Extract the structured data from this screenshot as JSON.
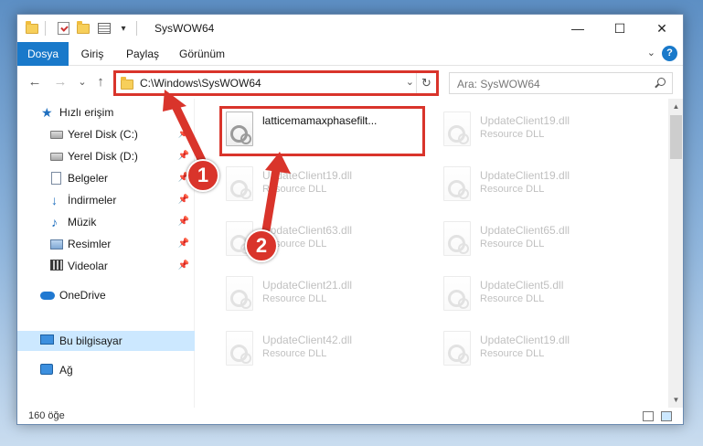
{
  "window": {
    "title": "SysWOW64"
  },
  "ribbon": {
    "tabs": [
      "Dosya",
      "Giriş",
      "Paylaş",
      "Görünüm"
    ],
    "help": "?"
  },
  "window_controls": {
    "minimize": "—",
    "maximize": "☐",
    "close": "✕"
  },
  "nav": {
    "back": "←",
    "forward": "→",
    "recent": "⌄",
    "up": "↑",
    "address": "C:\\Windows\\SysWOW64",
    "refresh": "↻",
    "search_placeholder": "Ara: SysWOW64"
  },
  "sidebar": {
    "items": [
      {
        "label": "Hızlı erişim",
        "icon": "star-icon"
      },
      {
        "label": "Yerel Disk (C:)",
        "icon": "drive-icon"
      },
      {
        "label": "Yerel Disk (D:)",
        "icon": "drive-icon"
      },
      {
        "label": "Belgeler",
        "icon": "documents-icon"
      },
      {
        "label": "İndirmeler",
        "icon": "download-icon"
      },
      {
        "label": "Müzik",
        "icon": "music-icon"
      },
      {
        "label": "Resimler",
        "icon": "pictures-icon"
      },
      {
        "label": "Videolar",
        "icon": "videos-icon"
      },
      {
        "label": "OneDrive",
        "icon": "cloud-icon"
      },
      {
        "label": "Bu bilgisayar",
        "icon": "computer-icon"
      },
      {
        "label": "Ağ",
        "icon": "network-icon"
      }
    ]
  },
  "files": [
    {
      "name": "latticemamaxphasefilt...",
      "type": ""
    },
    {
      "name": "UpdateClient19.dll",
      "type": "Resource DLL"
    },
    {
      "name": "UpdateClient19.dll",
      "type": "Resource DLL"
    },
    {
      "name": "UpdateClient19.dll",
      "type": "Resource DLL"
    },
    {
      "name": "UpdateClient63.dll",
      "type": "Resource DLL"
    },
    {
      "name": "UpdateClient65.dll",
      "type": "Resource DLL"
    },
    {
      "name": "UpdateClient21.dll",
      "type": "Resource DLL"
    },
    {
      "name": "UpdateClient5.dll",
      "type": "Resource DLL"
    },
    {
      "name": "UpdateClient42.dll",
      "type": "Resource DLL"
    },
    {
      "name": "UpdateClient19.dll",
      "type": "Resource DLL"
    }
  ],
  "status": {
    "count": "160 öğe"
  },
  "annotations": {
    "step1": "1",
    "step2": "2",
    "color": "#d9342b"
  }
}
